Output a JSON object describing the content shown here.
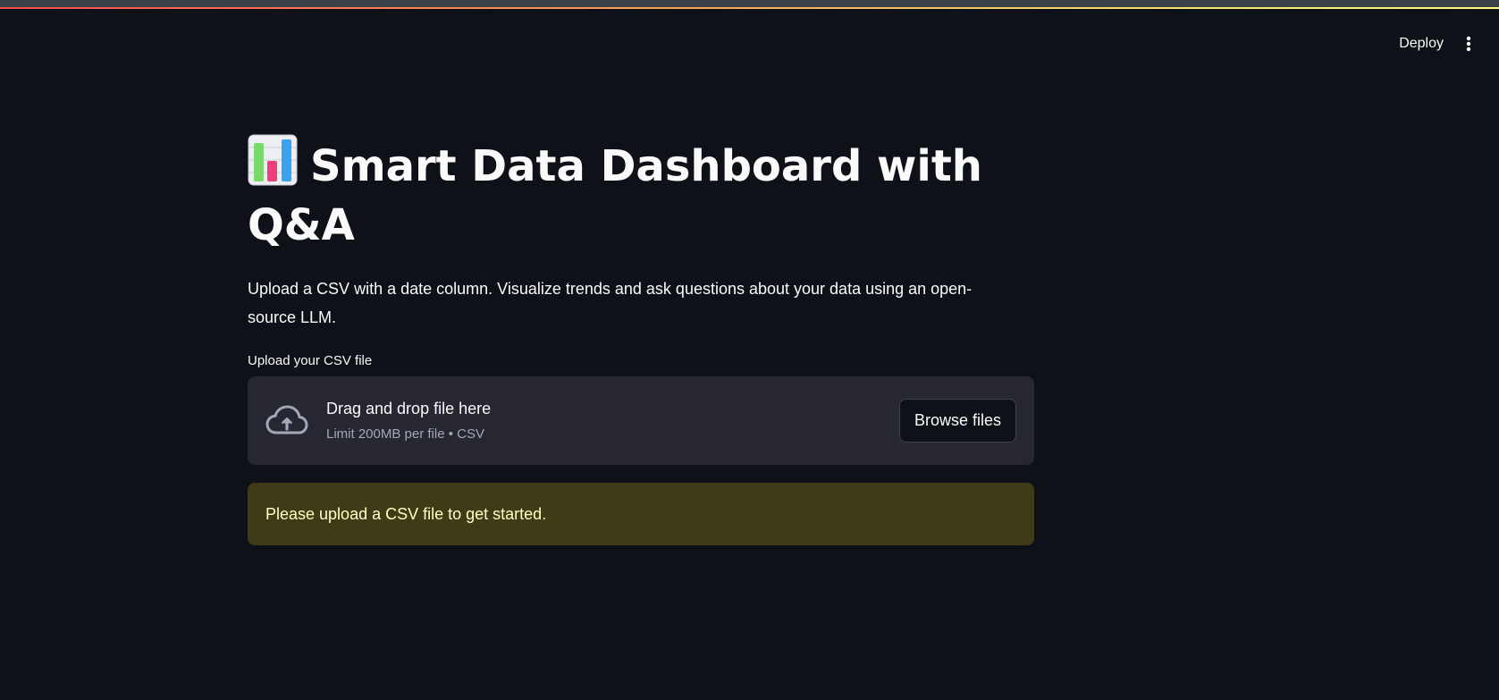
{
  "header": {
    "deploy_label": "Deploy",
    "menu_icon": "kebab-menu-icon"
  },
  "main": {
    "title_icon": "bar-chart-emoji",
    "title": "Smart Data Dashboard with Q&A",
    "subtitle": "Upload a CSV with a date column. Visualize trends and ask questions about your data using an open-source LLM.",
    "uploader": {
      "label": "Upload your CSV file",
      "icon": "cloud-upload-icon",
      "drop_title": "Drag and drop file here",
      "drop_limit": "Limit 200MB per file • CSV",
      "browse_label": "Browse files"
    },
    "warning": {
      "message": "Please upload a CSV file to get started."
    }
  },
  "colors": {
    "background": "#0e1117",
    "dropzone_bg": "#262730",
    "warning_bg": "#3e3b16",
    "warning_text": "#ffffc2",
    "accent_red": "#ff4b4b",
    "accent_yellow": "#fffd80"
  }
}
